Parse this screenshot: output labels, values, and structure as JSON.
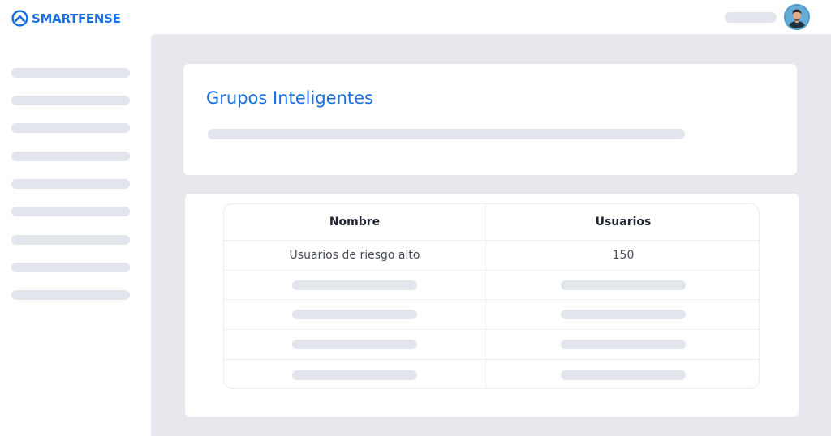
{
  "brand": {
    "name": "SMARTFENSE",
    "color": "#1a6fe0"
  },
  "header": {
    "avatar_icon": "user-avatar"
  },
  "sidebar": {
    "placeholder_count": 9
  },
  "page": {
    "title": "Grupos Inteligentes"
  },
  "table": {
    "columns": [
      "Nombre",
      "Usuarios"
    ],
    "rows": [
      {
        "name": "Usuarios de riesgo alto",
        "users": "150"
      }
    ],
    "placeholder_rows": 4
  },
  "colors": {
    "accent": "#1a6fe0",
    "background": "#e6e8ee",
    "skeleton": "#e3e5ec"
  }
}
